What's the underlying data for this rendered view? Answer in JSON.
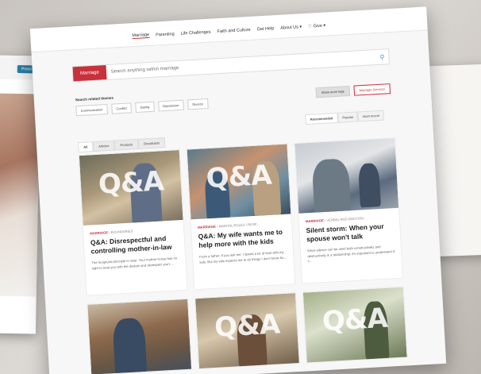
{
  "side_left": {
    "press_label": "Press"
  },
  "nav": {
    "items": [
      "Marriage",
      "Parenting",
      "Life Challenges",
      "Faith and Culture",
      "Get Help",
      "About Us ▾",
      "♡ Give ▾"
    ]
  },
  "search": {
    "tag": "Marriage",
    "placeholder": "Search anything within marriage"
  },
  "themes": {
    "label": "Search related themes",
    "chips": [
      "Communication",
      "Conflict",
      "Dating",
      "Depression",
      "Divorce"
    ],
    "more_label": "Show more tags",
    "services_label": "Marriage Services"
  },
  "sort_tabs": [
    "Recommended",
    "Popular",
    "Most recent"
  ],
  "filter_tabs": [
    "All",
    "Articles",
    "Products",
    "Broadcasts"
  ],
  "cards": [
    {
      "overlay": "Q&A",
      "category": "MARRIAGE",
      "subcategory": "BOUNDARIES",
      "title": "Q&A: Disrespectful and controlling mother-in-law",
      "excerpt": "The Scriptural principle is clear. Your mother-in-law has no right to treat you with the disdain and disrespect you'r..."
    },
    {
      "overlay": "Q&A",
      "category": "MARRIAGE",
      "subcategory": "MARITAL ROLES / RESP...",
      "title": "Q&A: My wife wants me to help more with the kids",
      "excerpt": "From a father: If you ask me, I spend a lot of time with my kids. But my wife expects me to do things I don't know ho..."
    },
    {
      "overlay": "",
      "category": "MARRIAGE",
      "subcategory": "VERBAL AND EMOTION...",
      "title": "Silent storm: When your spouse won't talk",
      "excerpt": "Since silence can be used both constructively and destructively in a relationship, it's important to understand if t..."
    },
    {
      "overlay": ""
    },
    {
      "overlay": "Q&A"
    },
    {
      "overlay": "Q&A"
    }
  ]
}
